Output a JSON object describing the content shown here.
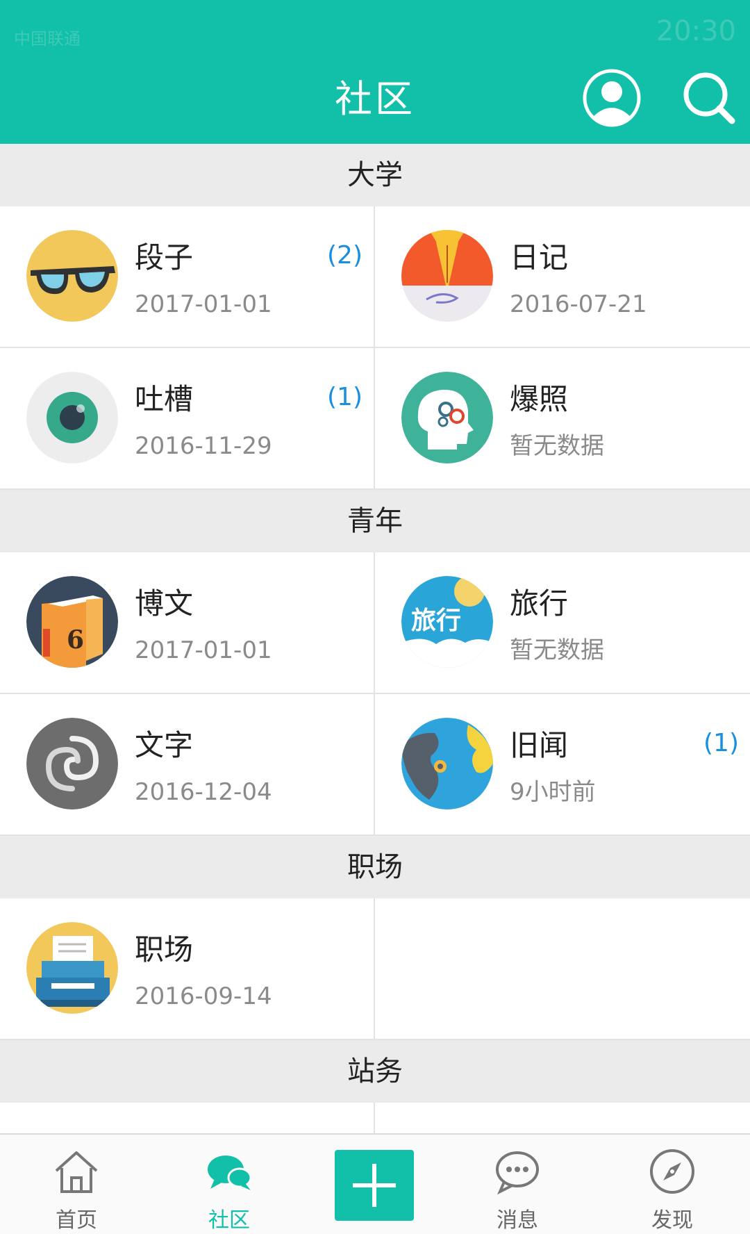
{
  "status_bar": {
    "carrier": "中国联通",
    "time": "20:30"
  },
  "header": {
    "title": "社区"
  },
  "sections": [
    {
      "title": "大学"
    },
    {
      "title": "青年"
    },
    {
      "title": "职场"
    },
    {
      "title": "站务"
    }
  ],
  "cells": [
    {
      "name": "段子",
      "date": "2017-01-01",
      "badge": "(2)",
      "icon": "glasses-icon"
    },
    {
      "name": "日记",
      "date": "2016-07-21",
      "badge": "",
      "icon": "pen-nib-icon"
    },
    {
      "name": "吐槽",
      "date": "2016-11-29",
      "badge": "(1)",
      "icon": "eye-icon"
    },
    {
      "name": "爆照",
      "date": "暂无数据",
      "badge": "",
      "icon": "head-gears-icon"
    },
    {
      "name": "博文",
      "date": "2017-01-01",
      "badge": "",
      "icon": "book-icon"
    },
    {
      "name": "旅行",
      "date": "暂无数据",
      "badge": "",
      "icon": "travel-icon",
      "icon_text": "旅行"
    },
    {
      "name": "文字",
      "date": "2016-12-04",
      "badge": "",
      "icon": "swirl-icon"
    },
    {
      "name": "旧闻",
      "date": "9小时前",
      "badge": "(1)",
      "icon": "globe-icon"
    },
    {
      "name": "职场",
      "date": "2016-09-14",
      "badge": "",
      "icon": "typewriter-icon"
    }
  ],
  "tabbar": {
    "tabs": [
      {
        "label": "首页",
        "icon": "home-icon"
      },
      {
        "label": "社区",
        "icon": "chat-bubbles-icon",
        "active": true
      },
      {
        "label": "",
        "icon": "plus-icon"
      },
      {
        "label": "消息",
        "icon": "message-icon"
      },
      {
        "label": "发现",
        "icon": "compass-icon"
      }
    ]
  },
  "colors": {
    "accent": "#12bfa8",
    "badge": "#1a8fe0",
    "section_bg": "#ebebeb"
  }
}
